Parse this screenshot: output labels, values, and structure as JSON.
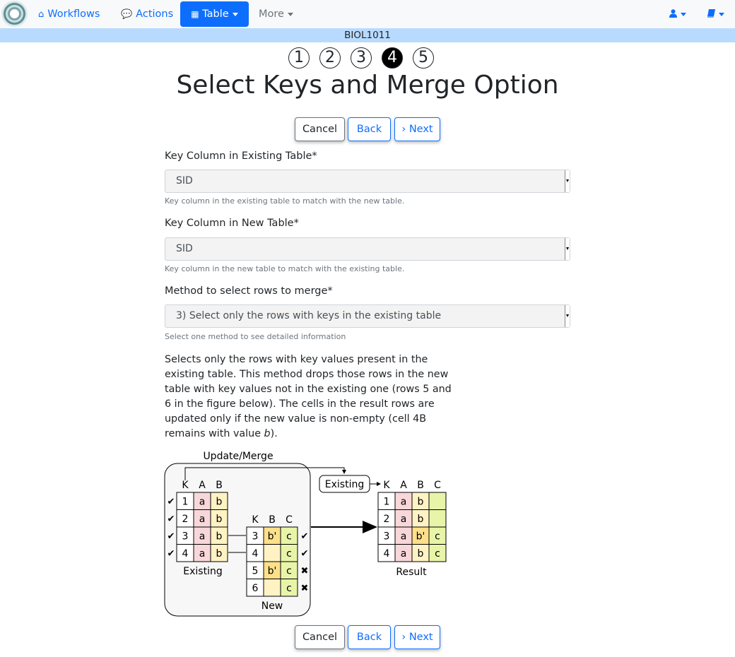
{
  "nav": {
    "workflows": "Workflows",
    "actions": "Actions",
    "table": "Table",
    "more": "More",
    "user_icon": "user-icon",
    "book_icon": "book-icon"
  },
  "course": "BIOL1011",
  "steps": [
    "1",
    "2",
    "3",
    "4",
    "5"
  ],
  "active_step": "4",
  "page_title": "Select Keys and Merge Option",
  "buttons": {
    "cancel": "Cancel",
    "back": "Back",
    "next": "Next"
  },
  "form": {
    "existing_key": {
      "label": "Key Column in Existing Table*",
      "value": "SID",
      "help": "Key column in the existing table to match with the new table."
    },
    "new_key": {
      "label": "Key Column in New Table*",
      "value": "SID",
      "help": "Key column in the new table to match with the existing table."
    },
    "method": {
      "label": "Method to select rows to merge*",
      "value": "3) Select only the rows with keys in the existing table",
      "help": "Select one method to see detailed information"
    }
  },
  "description": {
    "before_italic": "Selects only the rows with key values present in the existing table. This method drops those rows in the new table with key values not in the existing one (rows 5 and 6 in the figure below). The cells in the result rows are updated only if the new value is non-empty (cell 4B remains with value ",
    "italic": "b",
    "after_italic": ")."
  },
  "figure": {
    "update_merge": "Update/Merge",
    "existing_badge": "Existing",
    "existing_caption": "Existing",
    "new_caption": "New",
    "result_caption": "Result",
    "existing_headers": [
      "K",
      "A",
      "B"
    ],
    "existing_rows": [
      [
        "1",
        "a",
        "b"
      ],
      [
        "2",
        "a",
        "b"
      ],
      [
        "3",
        "a",
        "b"
      ],
      [
        "4",
        "a",
        "b"
      ]
    ],
    "new_headers": [
      "K",
      "B",
      "C"
    ],
    "new_rows": [
      [
        "3",
        "b'",
        "c"
      ],
      [
        "4",
        "",
        "c"
      ],
      [
        "5",
        "b'",
        "c"
      ],
      [
        "6",
        "",
        "c"
      ]
    ],
    "new_marks": [
      "✔",
      "✔",
      "✖",
      "✖"
    ],
    "existing_marks": [
      "✔",
      "✔",
      "✔",
      "✔"
    ],
    "result_headers": [
      "K",
      "A",
      "B",
      "C"
    ],
    "result_rows": [
      [
        "1",
        "a",
        "b",
        ""
      ],
      [
        "2",
        "a",
        "b",
        ""
      ],
      [
        "3",
        "a",
        "b'",
        "c"
      ],
      [
        "4",
        "a",
        "b",
        "c"
      ]
    ],
    "colors": {
      "key": "#ffffff",
      "a": "#f8d7da",
      "b": "#fff3c4",
      "b_new": "#ffe08a",
      "c": "#e8f5a8"
    }
  }
}
